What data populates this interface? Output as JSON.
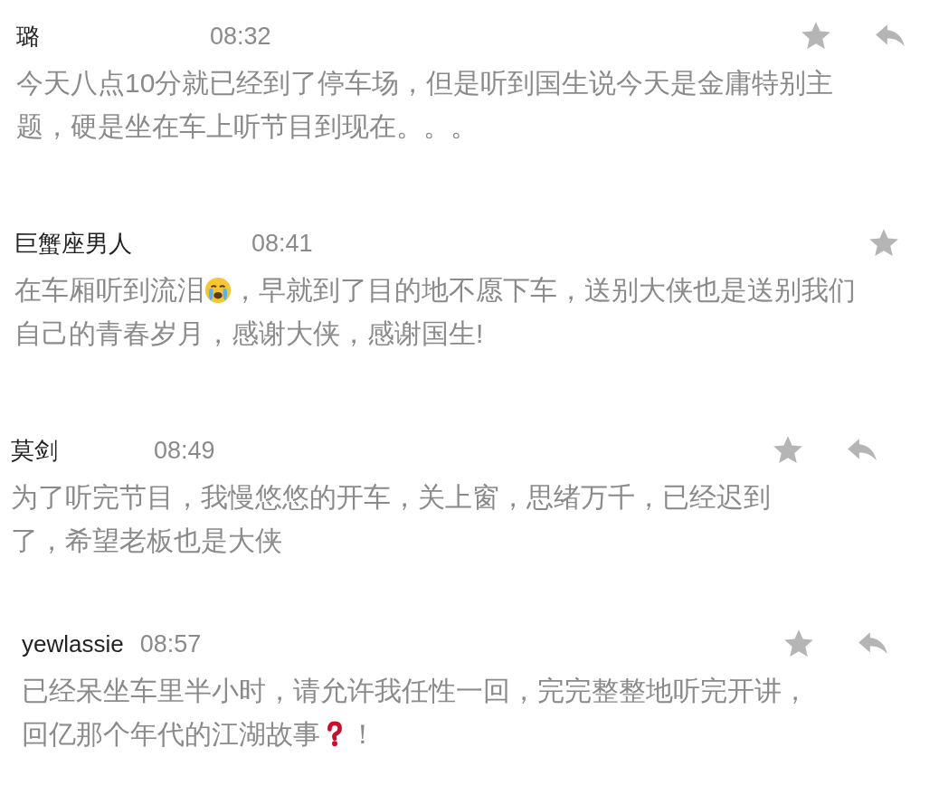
{
  "comments": [
    {
      "author": "璐",
      "time": "08:32",
      "starred": false,
      "reply": true,
      "lines": [
        [
          {
            "kind": "text",
            "text": "今天八点10分就已经到了停车场，但是听到国生说今天是金庸特别主"
          }
        ],
        [
          {
            "kind": "text",
            "text": "题，硬是坐在车上听节目到现在。。。"
          }
        ]
      ]
    },
    {
      "author": "巨蟹座男人",
      "time": "08:41",
      "starred": false,
      "reply": false,
      "lines": [
        [
          {
            "kind": "text",
            "text": "在车厢听到流泪"
          },
          {
            "kind": "crying-emoji"
          },
          {
            "kind": "text",
            "text": "，早就到了目的地不愿下车，送别大侠也是送别我们"
          }
        ],
        [
          {
            "kind": "text",
            "text": "自己的青春岁月，感谢大侠，感谢国生!"
          }
        ]
      ]
    },
    {
      "author": "莫剑",
      "time": "08:49",
      "starred": false,
      "reply": true,
      "lines": [
        [
          {
            "kind": "text",
            "text": "为了听完节目，我慢悠悠的开车，关上窗，思绪万千，已经迟到"
          }
        ],
        [
          {
            "kind": "text",
            "text": "了，希望老板也是大侠"
          }
        ]
      ]
    },
    {
      "author": "yewlassie",
      "time": "08:57",
      "starred": false,
      "reply": true,
      "lines": [
        [
          {
            "kind": "text",
            "text": "已经呆坐车里半小时，请允许我任性一回，完完整整地听完开讲，"
          }
        ],
        [
          {
            "kind": "text",
            "text": "回亿那个年代的江湖故事"
          },
          {
            "kind": "question-emoji"
          },
          {
            "kind": "text",
            "text": "！"
          }
        ]
      ]
    }
  ]
}
